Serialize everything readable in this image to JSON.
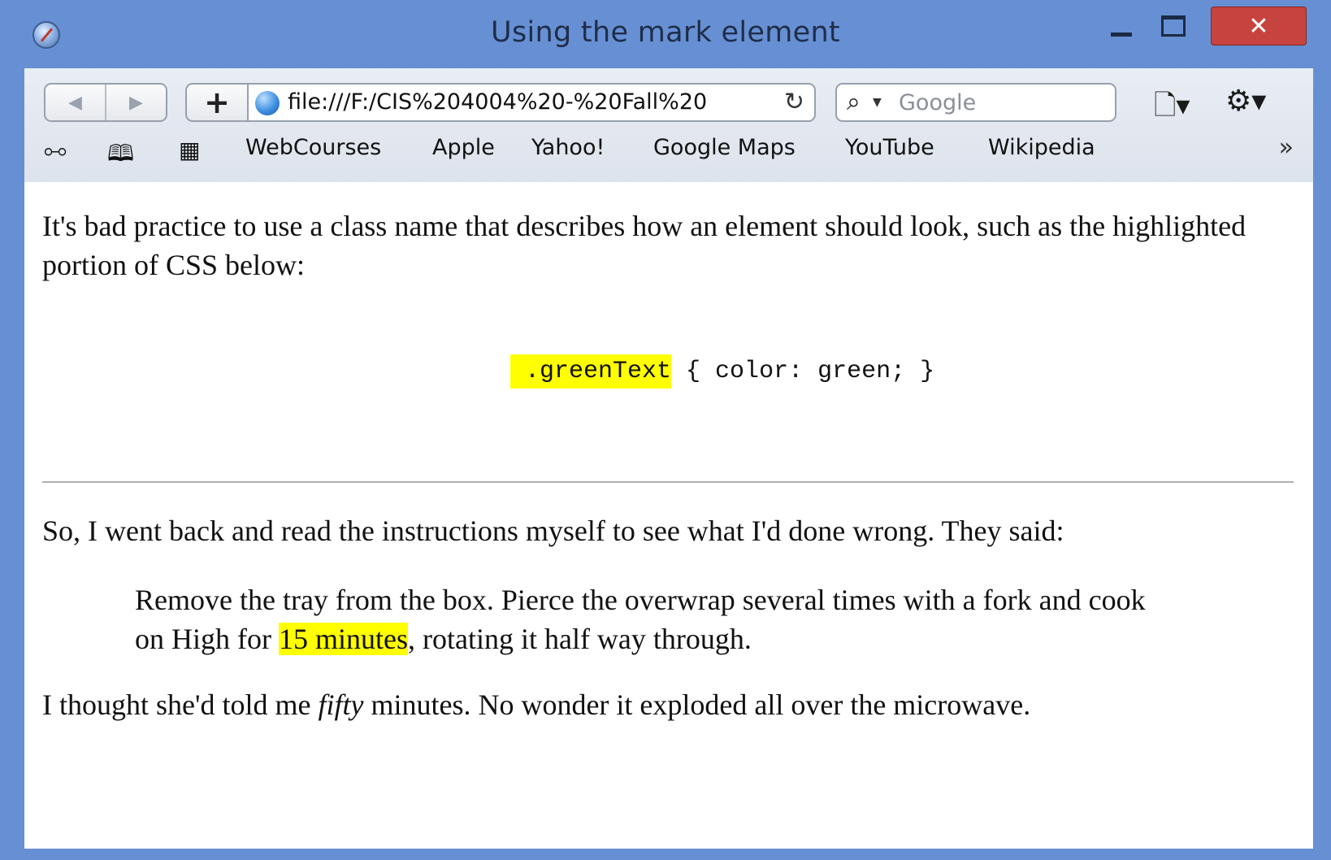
{
  "window": {
    "title": "Using the mark element",
    "minimize_label": "",
    "maximize_label": "",
    "close_label": "✕"
  },
  "toolbar": {
    "back_icon": "◀",
    "forward_icon": "▶",
    "add_label": "+",
    "url": "file:///F:/CIS%204004%20-%20Fall%20",
    "reload_icon": "↻",
    "search_placeholder": "Google",
    "search_icon": "🔍",
    "page_icon": "🗋▾",
    "gear_icon": "⚙▾"
  },
  "bookmarks": {
    "reading_list_icon": "👓",
    "bookmarks_icon": "📖",
    "top_sites_icon": "▦",
    "items": [
      "WebCourses",
      "Apple",
      "Yahoo!",
      "Google Maps",
      "YouTube",
      "Wikipedia"
    ],
    "more_icon": "»"
  },
  "content": {
    "paragraph1": "It's bad practice to use a class name that describes how an element should look, such as the highlighted portion of CSS below:",
    "code_highlight": " .greenText",
    "code_rest": " { color: green; }",
    "paragraph2": "So, I went back and read the instructions myself to see what I'd done wrong. They said:",
    "quote_before": "Remove the tray from the box. Pierce the overwrap several times with a fork and cook on High for ",
    "quote_mark": "15 minutes",
    "quote_after": ", rotating it half way through.",
    "p3_before": "I thought she'd told me ",
    "p3_em": "fifty",
    "p3_after": " minutes. No wonder it exploded all over the microwave."
  },
  "colors": {
    "titlebar": "#6690d3",
    "close_button": "#c7433f",
    "highlight": "#ffff00"
  }
}
